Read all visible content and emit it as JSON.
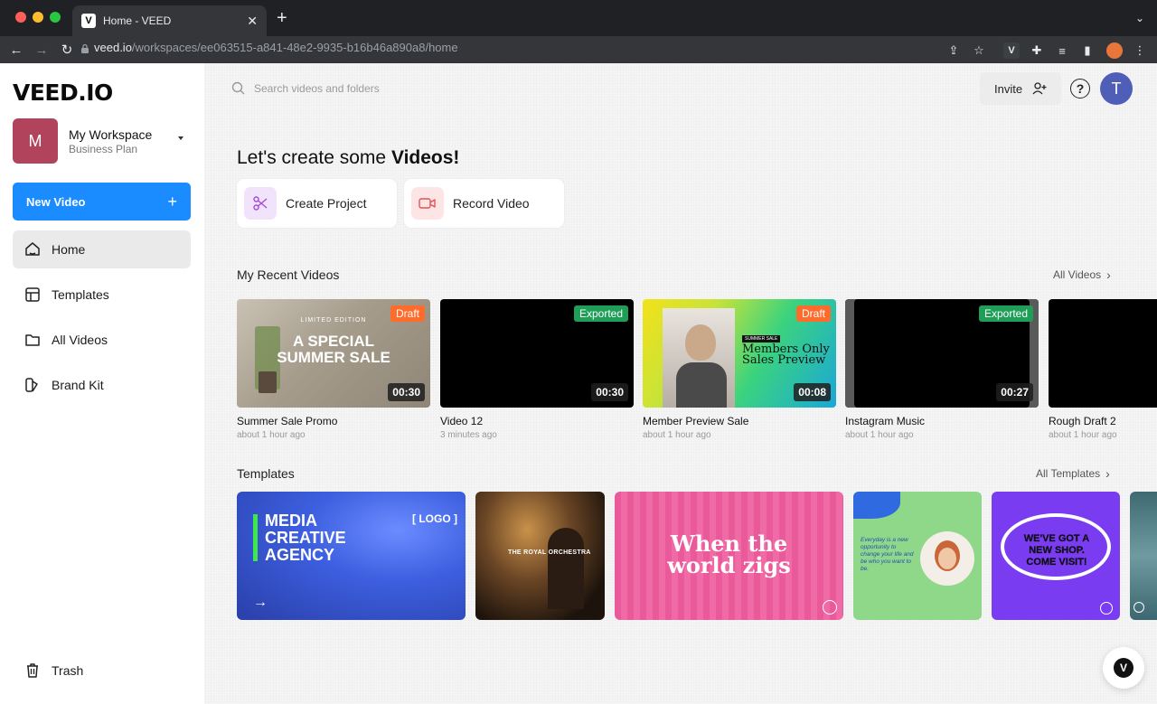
{
  "browser": {
    "tab_title": "Home - VEED",
    "tab_favicon": "V",
    "url_host": "veed.io",
    "url_path": "/workspaces/ee063515-a841-48e2-9935-b16b46a890a8/home"
  },
  "sidebar": {
    "logo": "VEED.IO",
    "workspace": {
      "initial": "M",
      "name": "My Workspace",
      "plan": "Business Plan"
    },
    "new_video": "New Video",
    "items": [
      {
        "label": "Home",
        "icon": "home-icon"
      },
      {
        "label": "Templates",
        "icon": "templates-icon"
      },
      {
        "label": "All Videos",
        "icon": "folder-icon"
      },
      {
        "label": "Brand Kit",
        "icon": "brand-kit-icon"
      }
    ],
    "trash": "Trash"
  },
  "header": {
    "search_placeholder": "Search videos and folders",
    "invite": "Invite",
    "help": "?",
    "avatar": "T"
  },
  "main": {
    "headline_prefix": "Let's create some ",
    "headline_bold": "Videos!",
    "quick_actions": [
      {
        "label": "Create Project",
        "icon": "scissors-icon"
      },
      {
        "label": "Record Video",
        "icon": "record-camera-icon"
      }
    ],
    "recent_title": "My Recent Videos",
    "recent_link": "All Videos",
    "videos": [
      {
        "title": "Summer Sale Promo",
        "meta": "about 1 hour ago",
        "status": "Draft",
        "duration": "00:30",
        "overlay_small": "LIMITED EDITION",
        "overlay_big": "A SPECIAL SUMMER SALE"
      },
      {
        "title": "Video 12",
        "meta": "3 minutes ago",
        "status": "Exported",
        "duration": "00:30"
      },
      {
        "title": "Member Preview Sale",
        "meta": "about 1 hour ago",
        "status": "Draft",
        "duration": "00:08",
        "overlay_small": "SUMMER SALE",
        "overlay_big": "Members Only Sales Preview"
      },
      {
        "title": "Instagram Music",
        "meta": "about 1 hour ago",
        "status": "Exported",
        "duration": "00:27"
      },
      {
        "title": "Rough Draft 2",
        "meta": "about 1 hour ago"
      }
    ],
    "templates_title": "Templates",
    "templates_link": "All Templates",
    "templates": [
      {
        "text": "MEDIA CREATIVE AGENCY",
        "tag": "[ LOGO ]"
      },
      {
        "text": "THE ROYAL ORCHESTRA"
      },
      {
        "text": "When the world zigs"
      },
      {
        "text": "Everyday is a new opportunity to change your life and be who you want to be."
      },
      {
        "text": "WE'VE GOT A NEW SHOP. COME VISIT!"
      },
      {
        "text": ""
      }
    ]
  },
  "colors": {
    "accent": "#1a8cff",
    "draft": "#ff6b2b",
    "exported": "#1e9e57",
    "workspace": "#b2435c",
    "avatar": "#4f5fb8"
  }
}
